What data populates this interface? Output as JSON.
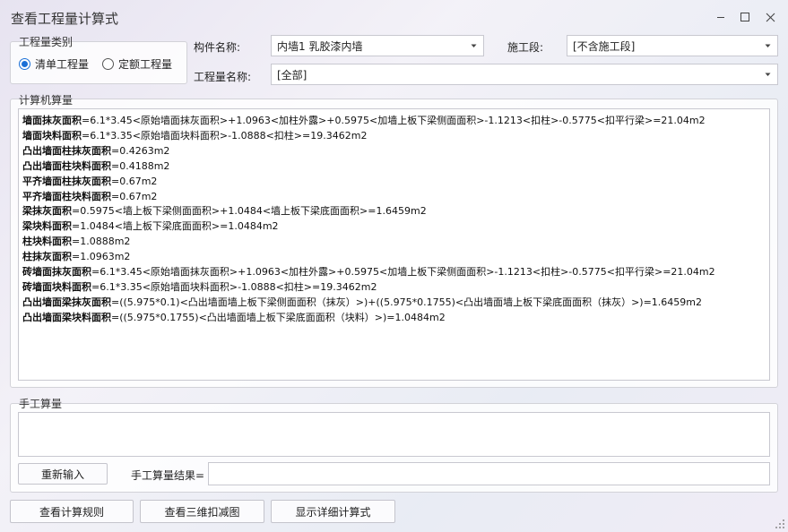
{
  "window": {
    "title": "查看工程量计算式"
  },
  "qty_type": {
    "label": "工程量类别",
    "options": [
      {
        "label": "清单工程量",
        "checked": true
      },
      {
        "label": "定额工程量",
        "checked": false
      }
    ]
  },
  "fields": {
    "component_label": "构件名称:",
    "component_value": "内墙1 乳胶漆内墙",
    "section_label": "施工段:",
    "section_value": "[不含施工段]",
    "qty_name_label": "工程量名称:",
    "qty_name_value": "[全部]"
  },
  "computer_calc": {
    "label": "计算机算量",
    "lines": [
      {
        "name": "墙面抹灰面积",
        "expr": "=6.1*3.45<原始墙面抹灰面积>+1.0963<加柱外露>+0.5975<加墙上板下梁侧面面积>-1.1213<扣柱>-0.5775<扣平行梁>=21.04m2"
      },
      {
        "name": "墙面块料面积",
        "expr": "=6.1*3.35<原始墙面块料面积>-1.0888<扣柱>=19.3462m2"
      },
      {
        "name": "凸出墙面柱抹灰面积",
        "expr": "=0.4263m2"
      },
      {
        "name": "凸出墙面柱块料面积",
        "expr": "=0.4188m2"
      },
      {
        "name": "平齐墙面柱抹灰面积",
        "expr": "=0.67m2"
      },
      {
        "name": "平齐墙面柱块料面积",
        "expr": "=0.67m2"
      },
      {
        "name": "梁抹灰面积",
        "expr": "=0.5975<墙上板下梁侧面面积>+1.0484<墙上板下梁底面面积>=1.6459m2"
      },
      {
        "name": "梁块料面积",
        "expr": "=1.0484<墙上板下梁底面面积>=1.0484m2"
      },
      {
        "name": "柱块料面积",
        "expr": "=1.0888m2"
      },
      {
        "name": "柱抹灰面积",
        "expr": "=1.0963m2"
      },
      {
        "name": "砖墙面抹灰面积",
        "expr": "=6.1*3.45<原始墙面抹灰面积>+1.0963<加柱外露>+0.5975<加墙上板下梁侧面面积>-1.1213<扣柱>-0.5775<扣平行梁>=21.04m2"
      },
      {
        "name": "砖墙面块料面积",
        "expr": "=6.1*3.35<原始墙面块料面积>-1.0888<扣柱>=19.3462m2"
      },
      {
        "name": "凸出墙面梁抹灰面积",
        "expr": "=((5.975*0.1)<凸出墙面墙上板下梁侧面面积（抹灰）>)+((5.975*0.1755)<凸出墙面墙上板下梁底面面积（抹灰）>)=1.6459m2"
      },
      {
        "name": "凸出墙面梁块料面积",
        "expr": "=((5.975*0.1755)<凸出墙面墙上板下梁底面面积（块料）>)=1.0484m2"
      }
    ]
  },
  "manual_calc": {
    "label": "手工算量",
    "reenter_button": "重新输入",
    "result_label": "手工算量结果=",
    "result_value": ""
  },
  "footer": {
    "view_rules": "查看计算规则",
    "view_3d": "查看三维扣减图",
    "show_detail": "显示详细计算式"
  },
  "colors": {
    "accent": "#1a6fd6",
    "border": "#c8c8d0"
  }
}
